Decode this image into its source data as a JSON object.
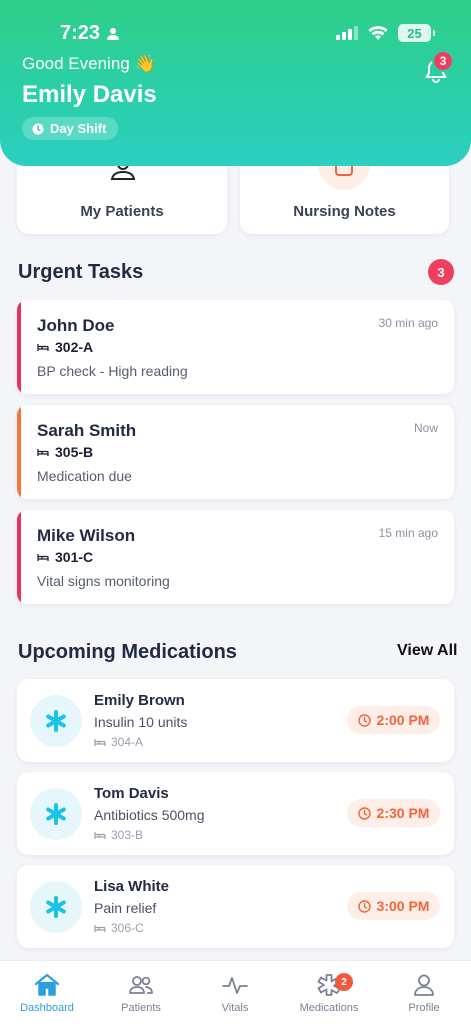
{
  "status_bar": {
    "time": "7:23",
    "battery": "25"
  },
  "header": {
    "greeting": "Good Evening 👋",
    "user_name": "Emily Davis",
    "shift": "Day Shift",
    "notification_count": "3"
  },
  "quick_actions": [
    {
      "label": "My Patients"
    },
    {
      "label": "Nursing Notes"
    }
  ],
  "urgent_tasks": {
    "title": "Urgent Tasks",
    "count": "3",
    "items": [
      {
        "patient": "John Doe",
        "room": "302-A",
        "description": "BP check - High reading",
        "time": "30 min ago",
        "priority_color": "#e8335a"
      },
      {
        "patient": "Sarah Smith",
        "room": "305-B",
        "description": "Medication due",
        "time": "Now",
        "priority_color": "#f2773e"
      },
      {
        "patient": "Mike Wilson",
        "room": "301-C",
        "description": "Vital signs monitoring",
        "time": "15 min ago",
        "priority_color": "#e8335a"
      }
    ]
  },
  "medications": {
    "title": "Upcoming Medications",
    "view_all": "View All",
    "items": [
      {
        "patient": "Emily Brown",
        "dose": "Insulin 10 units",
        "room": "304-A",
        "time": "2:00 PM"
      },
      {
        "patient": "Tom Davis",
        "dose": "Antibiotics 500mg",
        "room": "303-B",
        "time": "2:30 PM"
      },
      {
        "patient": "Lisa White",
        "dose": "Pain relief",
        "room": "306-C",
        "time": "3:00 PM"
      }
    ]
  },
  "bottom_nav": {
    "items": [
      {
        "label": "Dashboard",
        "icon": "home-icon",
        "active": true
      },
      {
        "label": "Patients",
        "icon": "users-icon"
      },
      {
        "label": "Vitals",
        "icon": "pulse-icon"
      },
      {
        "label": "Medications",
        "icon": "medical-icon",
        "badge": "2"
      },
      {
        "label": "Profile",
        "icon": "user-icon"
      }
    ]
  },
  "colors": {
    "accent": "#2c9fe0",
    "header_start": "#2ecf86",
    "header_end": "#2ccfc0",
    "urgent": "#ee3f5e",
    "med_time": "#f0653c"
  }
}
